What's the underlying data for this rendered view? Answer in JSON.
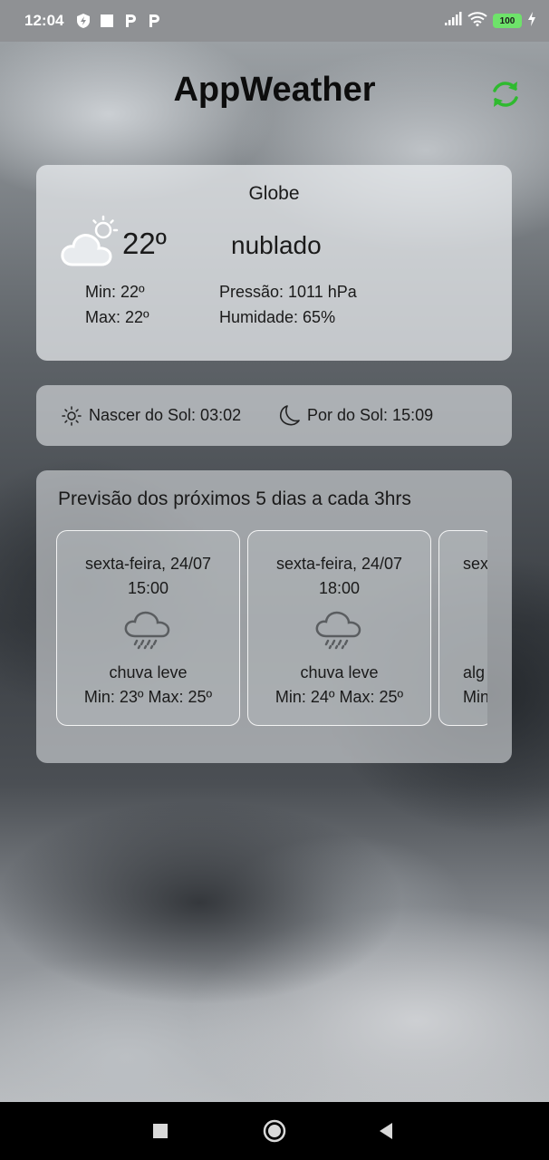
{
  "status_bar": {
    "time": "12:04",
    "battery": "100",
    "icons": [
      "shield-bolt-icon",
      "square-icon",
      "p-icon",
      "p-icon",
      "signal-icon",
      "wifi-icon",
      "battery-icon",
      "charging-icon"
    ]
  },
  "header": {
    "title": "AppWeather",
    "refresh_icon": "refresh-icon",
    "accent_color": "#2fba2f"
  },
  "current": {
    "city": "Globe",
    "temp": "22º",
    "description": "nublado",
    "min": "Min:  22º",
    "max": "Max: 22º",
    "pressure": "Pressão:  1011 hPa",
    "humidity": "Humidade: 65%",
    "icon": "partly-cloudy-icon"
  },
  "sun": {
    "sunrise": "Nascer do Sol: 03:02",
    "sunset": "Por do Sol: 15:09",
    "sunrise_icon": "sun-icon",
    "sunset_icon": "moon-icon"
  },
  "forecast": {
    "title": "Previsão dos próximos 5 dias a cada 3hrs",
    "items": [
      {
        "date": "sexta-feira, 24/07",
        "hour": "15:00",
        "desc": "chuva leve",
        "minmax": "Min: 23º  Max: 25º",
        "icon": "rain-cloud-icon"
      },
      {
        "date": "sexta-feira, 24/07",
        "hour": "18:00",
        "desc": "chuva leve",
        "minmax": "Min: 24º  Max: 25º",
        "icon": "rain-cloud-icon"
      },
      {
        "date": "sex",
        "desc": "alg",
        "minmax": "Min"
      }
    ]
  },
  "nav": {
    "recent": "recent-apps-icon",
    "home": "home-icon",
    "back": "back-icon"
  }
}
